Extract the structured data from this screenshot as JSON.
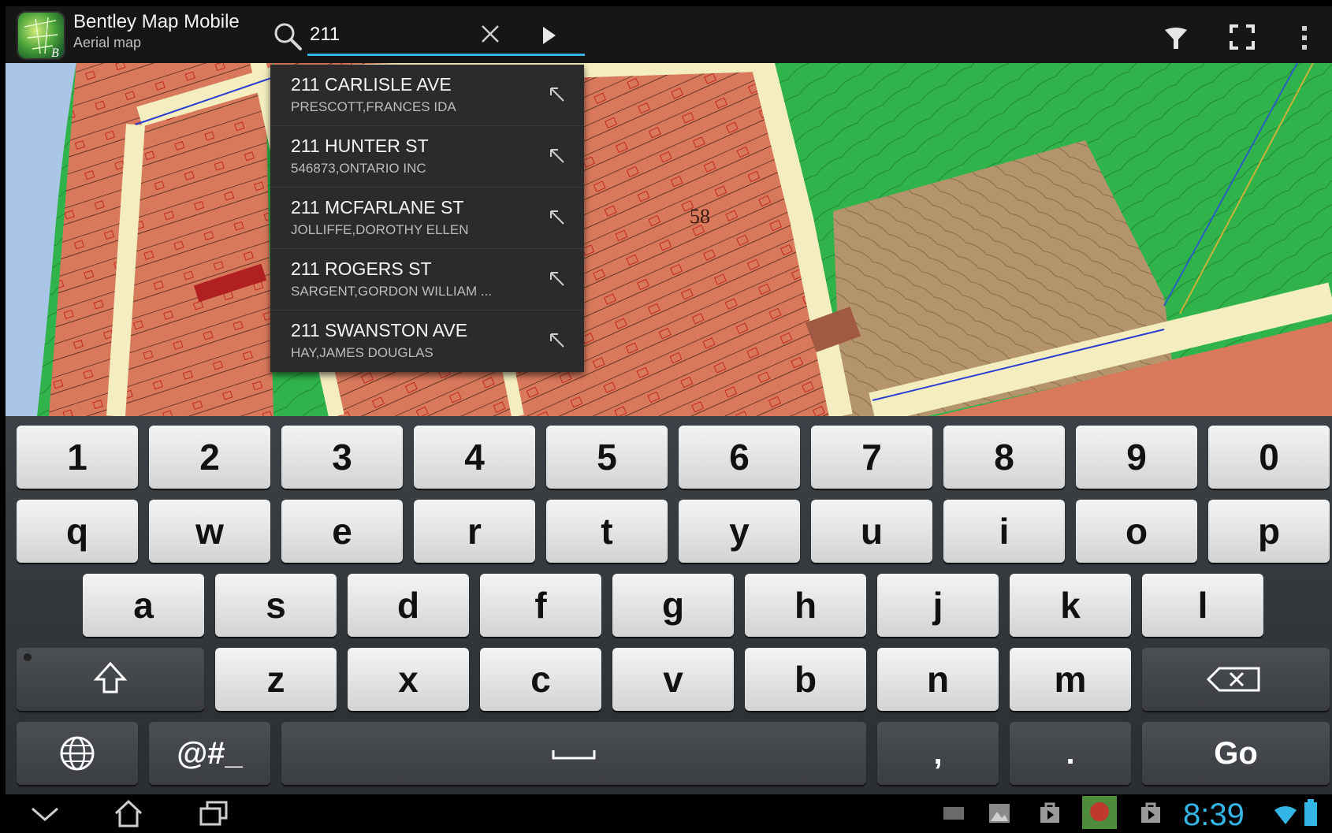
{
  "app": {
    "title": "Bentley Map Mobile",
    "subtitle": "Aerial map"
  },
  "search": {
    "value": "211"
  },
  "map": {
    "label": "58"
  },
  "suggestions": [
    {
      "address": "211 CARLISLE AVE",
      "owner": "PRESCOTT,FRANCES IDA"
    },
    {
      "address": "211 HUNTER ST",
      "owner": "546873,ONTARIO INC"
    },
    {
      "address": "211 MCFARLANE ST",
      "owner": "JOLLIFFE,DOROTHY ELLEN"
    },
    {
      "address": "211 ROGERS ST",
      "owner": "SARGENT,GORDON WILLIAM ..."
    },
    {
      "address": "211 SWANSTON AVE",
      "owner": "HAY,JAMES DOUGLAS"
    }
  ],
  "keyboard": {
    "row1": [
      "1",
      "2",
      "3",
      "4",
      "5",
      "6",
      "7",
      "8",
      "9",
      "0"
    ],
    "row2": [
      "q",
      "w",
      "e",
      "r",
      "t",
      "y",
      "u",
      "i",
      "o",
      "p"
    ],
    "row3": [
      "a",
      "s",
      "d",
      "f",
      "g",
      "h",
      "j",
      "k",
      "l"
    ],
    "row4": [
      "z",
      "x",
      "c",
      "v",
      "b",
      "n",
      "m"
    ],
    "symbols_label": "@#_",
    "comma_label": ",",
    "period_label": ".",
    "go_label": "Go"
  },
  "status": {
    "time": "8:39"
  },
  "colors": {
    "accent": "#33b5e5",
    "parcel": "#d9795c",
    "green": "#2fb34a",
    "road": "#f3edc0",
    "brown_lot": "#b3946b"
  },
  "icons": [
    "search-icon",
    "clear-icon",
    "play-arrow-icon",
    "filter-icon",
    "fullscreen-icon",
    "overflow-menu-icon",
    "north-west-arrow-icon",
    "shift-icon",
    "backspace-icon",
    "globe-icon",
    "space-icon",
    "chevron-down-icon",
    "home-icon",
    "recent-apps-icon",
    "keyboard-icon",
    "gallery-icon",
    "bag-icon",
    "app-thumbnail-icon",
    "wifi-icon",
    "battery-icon"
  ]
}
